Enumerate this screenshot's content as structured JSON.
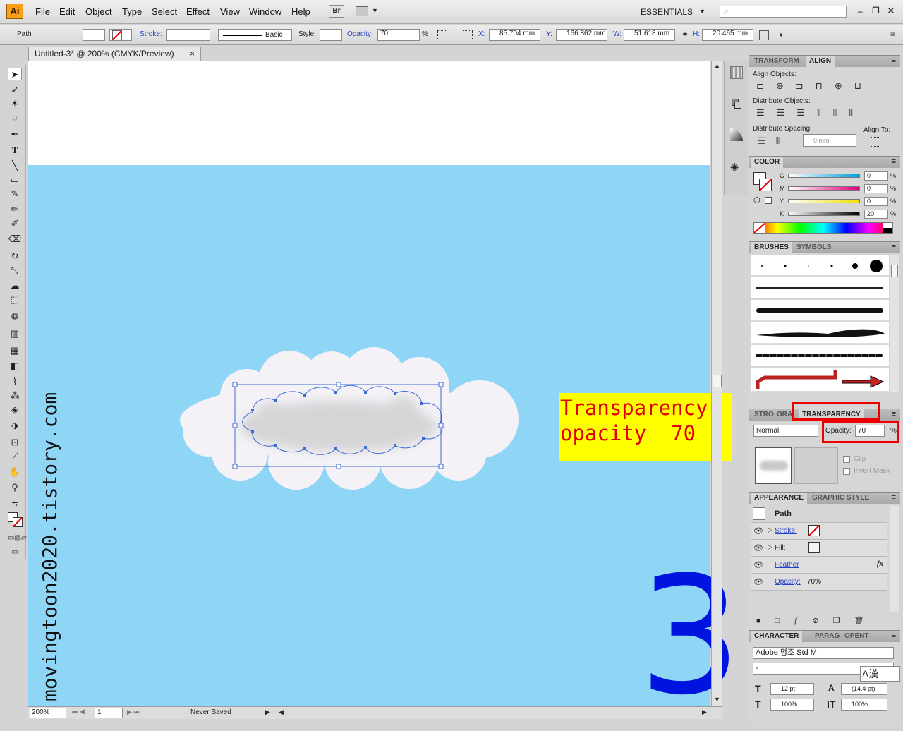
{
  "app": {
    "logo": "Ai",
    "workspace": "ESSENTIALS"
  },
  "menu": [
    "File",
    "Edit",
    "Object",
    "Type",
    "Select",
    "Effect",
    "View",
    "Window",
    "Help"
  ],
  "bridge_label": "Br",
  "control": {
    "object_type": "Path",
    "stroke_label": "Stroke:",
    "brush_label": "Basic",
    "style_label": "Style:",
    "opacity_label": "Opacity:",
    "opacity_value": "70",
    "percent": "%",
    "x_label": "X:",
    "x_value": "85.704 mm",
    "y_label": "Y:",
    "y_value": "166.862 mm",
    "w_label": "W:",
    "w_value": "51.618 mm",
    "h_label": "H:",
    "h_value": "20.465 mm"
  },
  "document": {
    "tab_title": "Untitled-3* @ 200% (CMYK/Preview)",
    "close": "×"
  },
  "status": {
    "zoom": "200%",
    "page": "1",
    "save_state": "Never Saved"
  },
  "align_panel": {
    "tab_transform": "TRANSFORM",
    "tab_align": "ALIGN",
    "align_objects": "Align Objects:",
    "distribute_objects": "Distribute Objects:",
    "distribute_spacing": "Distribute Spacing:",
    "align_to": "Align To:",
    "spacing_value": "0 mm"
  },
  "color_panel": {
    "title": "COLOR",
    "channels": [
      {
        "name": "C",
        "value": "0",
        "color": "#00a0e0"
      },
      {
        "name": "M",
        "value": "0",
        "color": "#e0007a"
      },
      {
        "name": "Y",
        "value": "0",
        "color": "#f0e000"
      },
      {
        "name": "K",
        "value": "20",
        "color": "#000000"
      }
    ],
    "percent": "%"
  },
  "brushes_panel": {
    "tab_brushes": "BRUSHES",
    "tab_symbols": "SYMBOLS"
  },
  "transparency_panel": {
    "tab_stroke": "STRO",
    "tab_gradient": "GRAI",
    "tab_transparency": "TRANSPARENCY",
    "blend_mode": "Normal",
    "opacity_label": "Opacity:",
    "opacity_value": "70",
    "percent": "%",
    "clip": "Clip",
    "invert_mask": "Invert Mask"
  },
  "appearance_panel": {
    "tab_appearance": "APPEARANCE",
    "tab_graphic_styles": "GRAPHIC STYLE",
    "object": "Path",
    "stroke": "Stroke:",
    "fill": "Fill:",
    "feather": "Feather",
    "fx": "fx",
    "opacity_label": "Opacity:",
    "opacity_value": "70%"
  },
  "character_panel": {
    "tab_character": "CHARACTER",
    "tab_paragraph": "PARAG",
    "tab_opentype": "OPENT",
    "font": "Adobe 명조 Std M",
    "style": "-",
    "size": "12 pt",
    "leading": "(14.4 pt)",
    "hscale": "100%",
    "vscale": "100%",
    "ime": "A漢"
  },
  "annotation": {
    "line1": "Transparency",
    "line2": "opacity  70"
  },
  "watermark": "movingtoon2020.tistory.com",
  "step_number": "3",
  "colors": {
    "sky": "#8fd6f6",
    "cloud": "#f4f2f6",
    "annotation_bg": "#ffff00",
    "annotation_text": "#e00000",
    "step": "#0014e0",
    "selection": "#3b6cd6"
  }
}
